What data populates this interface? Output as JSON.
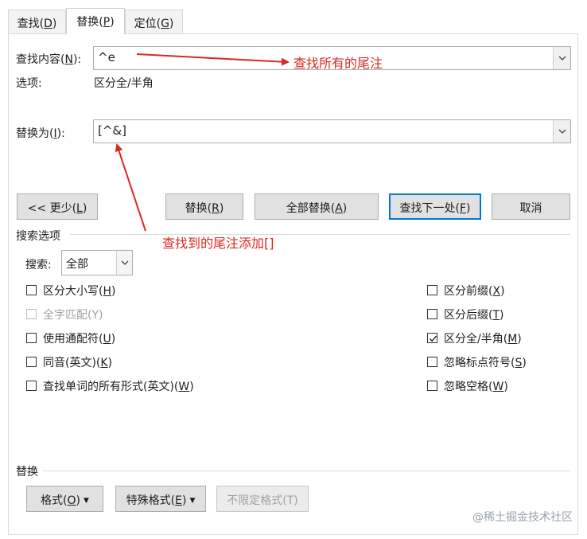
{
  "tabs": [
    {
      "label": "查找(",
      "key": "D",
      "close": ")"
    },
    {
      "label": "替换(",
      "key": "P",
      "close": ")"
    },
    {
      "label": "定位(",
      "key": "G",
      "close": ")"
    }
  ],
  "find": {
    "label": "查找内容(",
    "key": "N",
    "close": "):",
    "value": "^e"
  },
  "options": {
    "label": "选项:",
    "value": "区分全/半角"
  },
  "replace": {
    "label": "替换为(",
    "key": "I",
    "close": "):",
    "value": "[^&]"
  },
  "buttons": {
    "less": {
      "label": "<< 更少(",
      "key": "L",
      "close": ")"
    },
    "replace": {
      "label": "替换(",
      "key": "R",
      "close": ")"
    },
    "replace_all": {
      "label": "全部替换(",
      "key": "A",
      "close": ")"
    },
    "find_next": {
      "label": "查找下一处(",
      "key": "F",
      "close": ")"
    },
    "cancel": {
      "label": "取消"
    }
  },
  "search_options": {
    "title": "搜索选项",
    "search_label": "搜索",
    "search_colon": ":",
    "search_value": "全部"
  },
  "checkboxes_left": [
    {
      "label": "区分大小写(",
      "key": "H",
      "close": ")",
      "checked": false,
      "disabled": false
    },
    {
      "label": "全字匹配(Y)",
      "key": "",
      "close": "",
      "checked": false,
      "disabled": true
    },
    {
      "label": "使用通配符(",
      "key": "U",
      "close": ")",
      "checked": false,
      "disabled": false
    },
    {
      "label": "同音(英文)(",
      "key": "K",
      "close": ")",
      "checked": false,
      "disabled": false
    },
    {
      "label": "查找单词的所有形式(英文)(",
      "key": "W",
      "close": ")",
      "checked": false,
      "disabled": false
    }
  ],
  "checkboxes_right": [
    {
      "label": "区分前缀(",
      "key": "X",
      "close": ")",
      "checked": false,
      "disabled": false
    },
    {
      "label": "区分后缀(",
      "key": "T",
      "close": ")",
      "checked": false,
      "disabled": false
    },
    {
      "label": "区分全/半角(",
      "key": "M",
      "close": ")",
      "checked": true,
      "disabled": false
    },
    {
      "label": "忽略标点符号(",
      "key": "S",
      "close": ")",
      "checked": false,
      "disabled": false
    },
    {
      "label": "忽略空格(",
      "key": "W",
      "close": ")",
      "checked": false,
      "disabled": false
    }
  ],
  "replace_section": {
    "title": "替换",
    "format": {
      "label": "格式(",
      "key": "O",
      "close": ")"
    },
    "special": {
      "label": "特殊格式(",
      "key": "E",
      "close": ")"
    },
    "no_format": {
      "label": "不限定格式(T)"
    }
  },
  "annotations": {
    "find_note": "查找所有的尾注",
    "replace_note": "查找到的尾注添加[]"
  },
  "watermark": "@稀土掘金技术社区",
  "colors": {
    "annotation": "#d9291f",
    "primary_border": "#0078d7"
  }
}
